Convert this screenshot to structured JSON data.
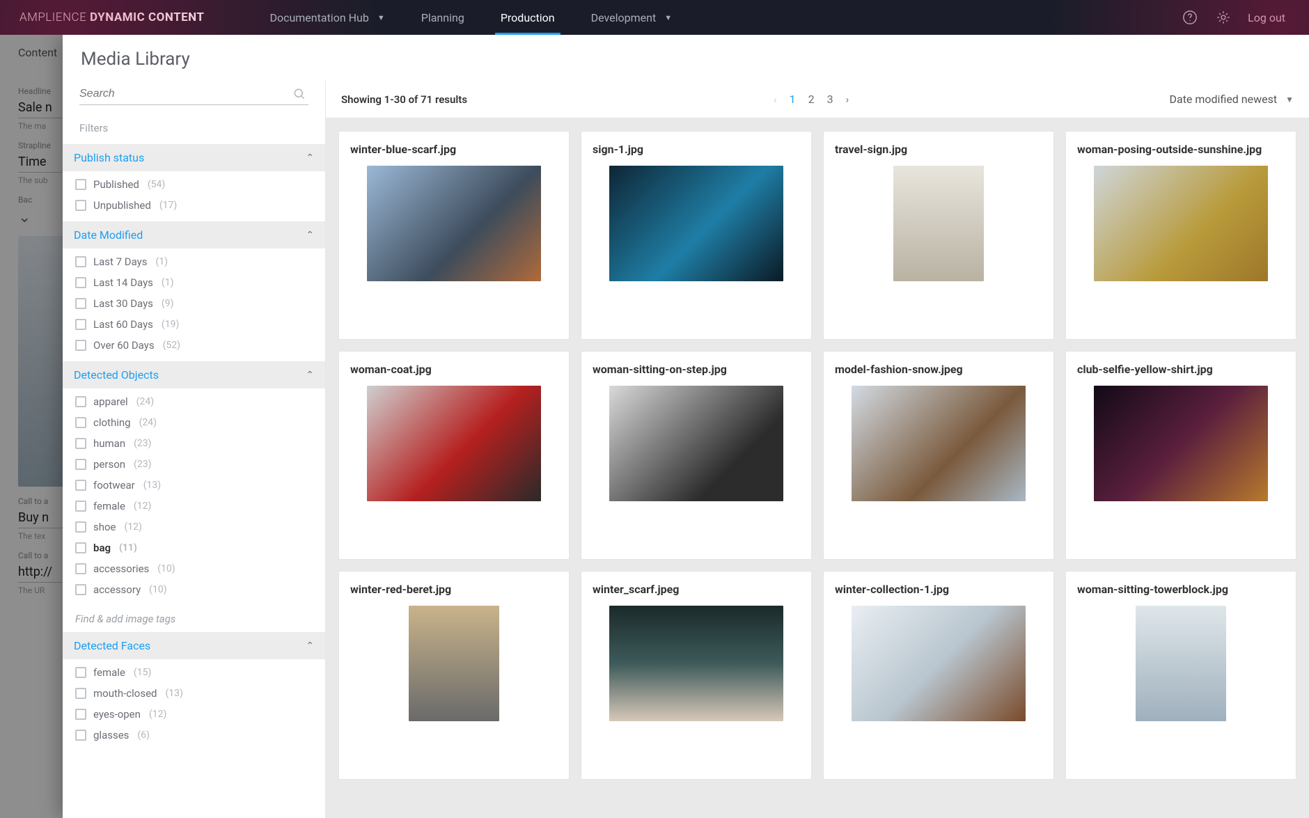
{
  "brand": {
    "light": "AMPLIENCE",
    "bold": "DYNAMIC CONTENT"
  },
  "nav": {
    "items": [
      {
        "label": "Documentation Hub",
        "dropdown": true,
        "active": false
      },
      {
        "label": "Planning",
        "dropdown": false,
        "active": false
      },
      {
        "label": "Production",
        "dropdown": false,
        "active": true
      },
      {
        "label": "Development",
        "dropdown": true,
        "active": false
      }
    ],
    "logout": "Log out"
  },
  "underlay": {
    "page_title": "Content",
    "fields": [
      {
        "label": "Headline",
        "value": "Sale n",
        "help": "The ma"
      },
      {
        "label": "Strapline",
        "value": "Time",
        "help": "The sub"
      },
      {
        "label": "Bac",
        "value": "",
        "help": ""
      },
      {
        "label": "Call to a",
        "value": "Buy n",
        "help": "The tex"
      },
      {
        "label": "Call to a",
        "value": "http://",
        "help": "The UR"
      }
    ]
  },
  "panel": {
    "title": "Media Library",
    "search_placeholder": "Search",
    "filters_label": "Filters",
    "find_tags_placeholder": "Find & add image tags",
    "facets": [
      {
        "title": "Publish status",
        "options": [
          {
            "label": "Published",
            "count": "(54)"
          },
          {
            "label": "Unpublished",
            "count": "(17)"
          }
        ]
      },
      {
        "title": "Date Modified",
        "options": [
          {
            "label": "Last 7 Days",
            "count": "(1)"
          },
          {
            "label": "Last 14 Days",
            "count": "(1)"
          },
          {
            "label": "Last 30 Days",
            "count": "(9)"
          },
          {
            "label": "Last 60 Days",
            "count": "(19)"
          },
          {
            "label": "Over 60 Days",
            "count": "(52)"
          }
        ]
      },
      {
        "title": "Detected Objects",
        "options": [
          {
            "label": "apparel",
            "count": "(24)"
          },
          {
            "label": "clothing",
            "count": "(24)"
          },
          {
            "label": "human",
            "count": "(23)"
          },
          {
            "label": "person",
            "count": "(23)"
          },
          {
            "label": "footwear",
            "count": "(13)"
          },
          {
            "label": "female",
            "count": "(12)"
          },
          {
            "label": "shoe",
            "count": "(12)"
          },
          {
            "label": "bag",
            "count": "(11)",
            "strong": true
          },
          {
            "label": "accessories",
            "count": "(10)"
          },
          {
            "label": "accessory",
            "count": "(10)"
          }
        ]
      },
      {
        "title": "Detected Faces",
        "options": [
          {
            "label": "female",
            "count": "(15)"
          },
          {
            "label": "mouth-closed",
            "count": "(13)"
          },
          {
            "label": "eyes-open",
            "count": "(12)"
          },
          {
            "label": "glasses",
            "count": "(6)"
          }
        ]
      }
    ]
  },
  "results": {
    "count_text": "Showing 1-30 of 71 results",
    "pages": [
      "1",
      "2",
      "3"
    ],
    "active_page": "1",
    "sort_label": "Date modified newest",
    "cards": [
      {
        "name": "winter-blue-scarf.jpg",
        "shape": "land",
        "g": "g1"
      },
      {
        "name": "sign-1.jpg",
        "shape": "land",
        "g": "g2"
      },
      {
        "name": "travel-sign.jpg",
        "shape": "port",
        "g": "g3"
      },
      {
        "name": "woman-posing-outside-sunshine.jpg",
        "shape": "land",
        "g": "g4"
      },
      {
        "name": "woman-coat.jpg",
        "shape": "land",
        "g": "g5"
      },
      {
        "name": "woman-sitting-on-step.jpg",
        "shape": "land",
        "g": "g6"
      },
      {
        "name": "model-fashion-snow.jpeg",
        "shape": "land",
        "g": "g7"
      },
      {
        "name": "club-selfie-yellow-shirt.jpg",
        "shape": "land",
        "g": "g8"
      },
      {
        "name": "winter-red-beret.jpg",
        "shape": "port",
        "g": "g9"
      },
      {
        "name": "winter_scarf.jpeg",
        "shape": "land",
        "g": "g10"
      },
      {
        "name": "winter-collection-1.jpg",
        "shape": "land",
        "g": "g11"
      },
      {
        "name": "woman-sitting-towerblock.jpg",
        "shape": "port",
        "g": "g12"
      }
    ]
  }
}
